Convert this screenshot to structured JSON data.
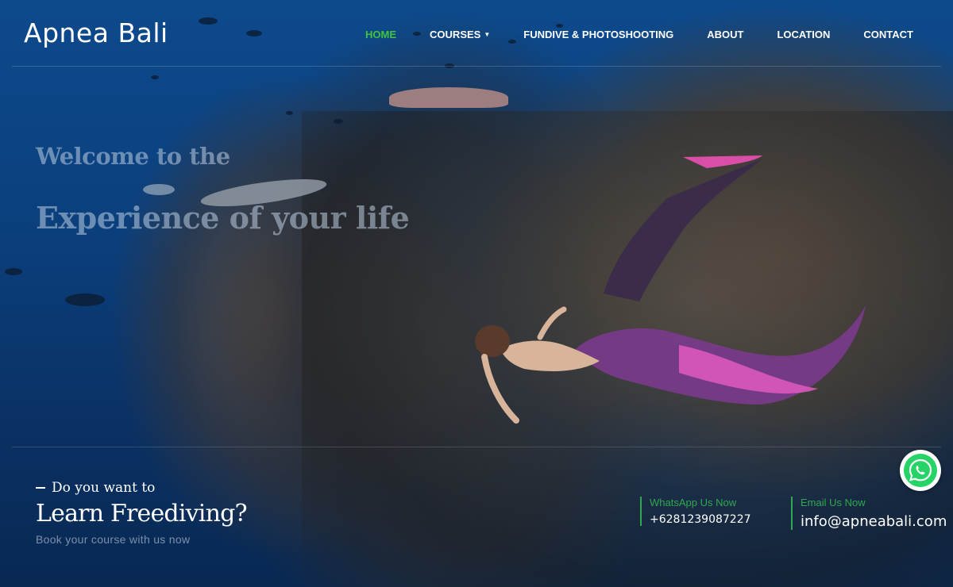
{
  "brand": {
    "name": "Apnea Bali"
  },
  "nav": {
    "items": [
      {
        "label": "HOME",
        "active": true
      },
      {
        "label": "COURSES",
        "dropdown": true
      },
      {
        "label": "FUNDIVE & PHOTOSHOOTING"
      },
      {
        "label": "ABOUT"
      },
      {
        "label": "LOCATION"
      },
      {
        "label": "CONTACT"
      }
    ]
  },
  "hero": {
    "line1": "Welcome to the",
    "line2": "Experience of your life",
    "image_subject": "underwater-freediver-shipwreck"
  },
  "cta": {
    "kicker": "Do you want to",
    "title": "Learn Freediving?",
    "subtitle": "Book your course with us now"
  },
  "contacts": {
    "whatsapp": {
      "label": "WhatsApp Us Now",
      "value": "+6281239087227"
    },
    "email": {
      "label": "Email Us Now",
      "value": "info@apneabali.com"
    }
  },
  "colors": {
    "accent_green": "#3ec43e",
    "contact_green": "#2fa84f",
    "ocean_blue": "#0b3f7c"
  },
  "icons": {
    "floating_button": "whatsapp-icon"
  }
}
